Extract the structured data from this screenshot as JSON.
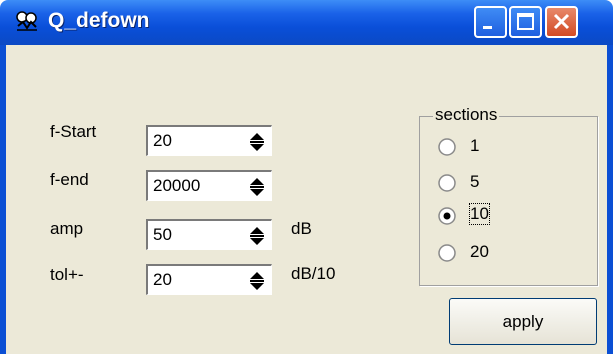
{
  "window": {
    "title": "Q_defown",
    "app_icon": "app-glyph-icon"
  },
  "fields": [
    {
      "label": "f-Start",
      "value": "20",
      "unit": ""
    },
    {
      "label": "f-end",
      "value": "20000",
      "unit": ""
    },
    {
      "label": "amp",
      "value": "50",
      "unit": "dB"
    },
    {
      "label": "tol+-",
      "value": "20",
      "unit": "dB/10"
    }
  ],
  "sections": {
    "title": "sections",
    "options": [
      "1",
      "5",
      "10",
      "20"
    ],
    "selected": "10"
  },
  "apply_label": "apply",
  "colors": {
    "titlebar": "#0a4fd9",
    "client": "#ece9d8",
    "close": "#d24a24"
  }
}
